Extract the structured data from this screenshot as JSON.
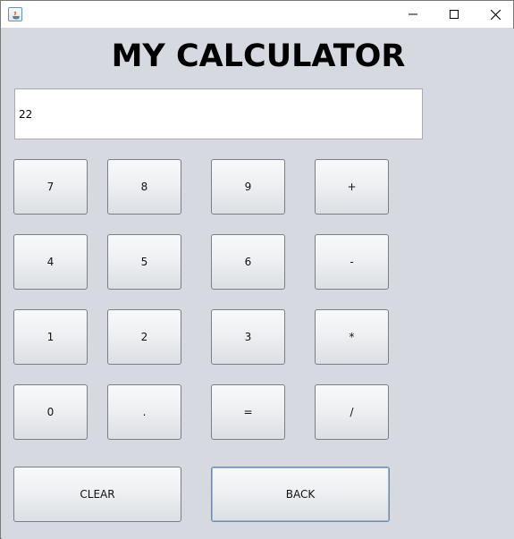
{
  "window": {
    "title": "",
    "controls": [
      "minimize-icon",
      "maximize-icon",
      "close-icon"
    ]
  },
  "app": {
    "heading": "MY CALCULATOR"
  },
  "display": {
    "value": "22"
  },
  "keypad": {
    "row1": [
      "7",
      "8",
      "9",
      "+"
    ],
    "row2": [
      "4",
      "5",
      "6",
      "-"
    ],
    "row3": [
      "1",
      "2",
      "3",
      "*"
    ],
    "row4": [
      "0",
      ".",
      "=",
      "/"
    ]
  },
  "actions": {
    "clear_label": "CLEAR",
    "back_label": "BACK"
  },
  "colors": {
    "background": "#d6d9df",
    "titlebar": "#ffffff",
    "focus_border": "#6c8cae"
  }
}
